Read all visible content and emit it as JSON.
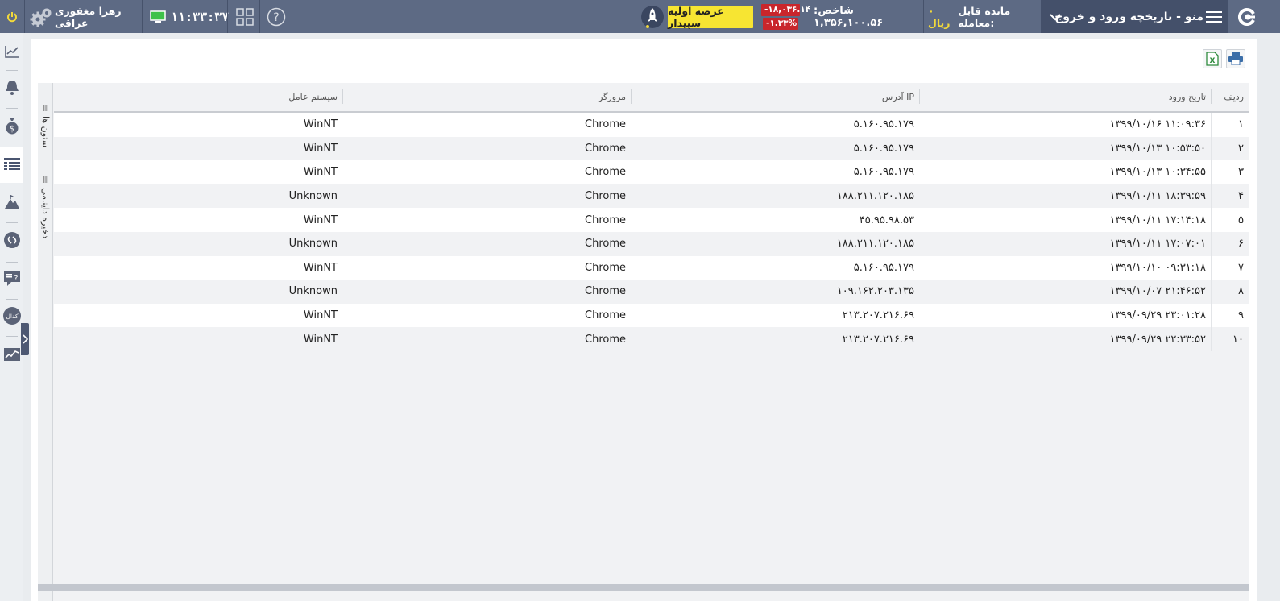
{
  "topbar": {
    "user_name": "زهرا مغفوری عراقی",
    "clock": "۱۱:۳۳:۳۷",
    "ipo_button": "عرضه اولیه سپیدار",
    "index_change": "-۱۸,۰۳۶.۱۴",
    "index_change_pct": "-۱.۳۳%",
    "index_label": "شاخص: ۱,۳۵۶,۱۰۰.۵۶",
    "balance_label": "مانده قابل معامله:",
    "balance_value": "۰ ریال",
    "page_title": "منو - تاریخچه ورود و خروج"
  },
  "colors": {
    "topbar_bg": "#5d6a84",
    "menu_bg": "#44506a",
    "ipo_bg": "#f7e532",
    "negative": "#c9262c",
    "accent_yellow": "#f2d93b"
  },
  "icons": {
    "topbar": [
      "power-icon",
      "gear-icon",
      "monitor-icon",
      "grid-icon",
      "help-icon",
      "rocket-icon",
      "chevron-down-icon",
      "hamburger-icon",
      "logo-icon"
    ],
    "rail": [
      "chart-icon",
      "bell-icon",
      "money-bag-icon",
      "table-list-icon",
      "mountain-icon",
      "link-icon",
      "question-list-icon",
      "badge-icon",
      "stock-chart-icon"
    ],
    "toolbar": [
      "print-icon",
      "excel-icon"
    ]
  },
  "rail": {
    "badge_text": "کدال"
  },
  "side_strip": {
    "columns_label": "ستون ها",
    "database_label": "ذخیره داینامی"
  },
  "table": {
    "headers": {
      "row": "ردیف",
      "date": "تاریخ ورود",
      "ip": "آدرس IP",
      "browser": "مرورگر",
      "os": "سیستم عامل"
    },
    "rows": [
      {
        "row": "۱",
        "date": "۱۳۹۹/۱۰/۱۶ ۱۱:۰۹:۳۶",
        "ip": "۵.۱۶۰.۹۵.۱۷۹",
        "browser": "Chrome",
        "os": "WinNT"
      },
      {
        "row": "۲",
        "date": "۱۳۹۹/۱۰/۱۳ ۱۰:۵۳:۵۰",
        "ip": "۵.۱۶۰.۹۵.۱۷۹",
        "browser": "Chrome",
        "os": "WinNT"
      },
      {
        "row": "۳",
        "date": "۱۳۹۹/۱۰/۱۳ ۱۰:۳۴:۵۵",
        "ip": "۵.۱۶۰.۹۵.۱۷۹",
        "browser": "Chrome",
        "os": "WinNT"
      },
      {
        "row": "۴",
        "date": "۱۳۹۹/۱۰/۱۱ ۱۸:۳۹:۵۹",
        "ip": "۱۸۸.۲۱۱.۱۲۰.۱۸۵",
        "browser": "Chrome",
        "os": "Unknown"
      },
      {
        "row": "۵",
        "date": "۱۳۹۹/۱۰/۱۱ ۱۷:۱۴:۱۸",
        "ip": "۴۵.۹۵.۹۸.۵۳",
        "browser": "Chrome",
        "os": "WinNT"
      },
      {
        "row": "۶",
        "date": "۱۳۹۹/۱۰/۱۱ ۱۷:۰۷:۰۱",
        "ip": "۱۸۸.۲۱۱.۱۲۰.۱۸۵",
        "browser": "Chrome",
        "os": "Unknown"
      },
      {
        "row": "۷",
        "date": "۱۳۹۹/۱۰/۱۰ ۰۹:۳۱:۱۸",
        "ip": "۵.۱۶۰.۹۵.۱۷۹",
        "browser": "Chrome",
        "os": "WinNT"
      },
      {
        "row": "۸",
        "date": "۱۳۹۹/۱۰/۰۷ ۲۱:۴۶:۵۲",
        "ip": "۱۰۹.۱۶۲.۲۰۳.۱۳۵",
        "browser": "Chrome",
        "os": "Unknown"
      },
      {
        "row": "۹",
        "date": "۱۳۹۹/۰۹/۲۹ ۲۳:۰۱:۲۸",
        "ip": "۲۱۳.۲۰۷.۲۱۶.۶۹",
        "browser": "Chrome",
        "os": "WinNT"
      },
      {
        "row": "۱۰",
        "date": "۱۳۹۹/۰۹/۲۹ ۲۲:۳۳:۵۲",
        "ip": "۲۱۳.۲۰۷.۲۱۶.۶۹",
        "browser": "Chrome",
        "os": "WinNT"
      }
    ]
  }
}
